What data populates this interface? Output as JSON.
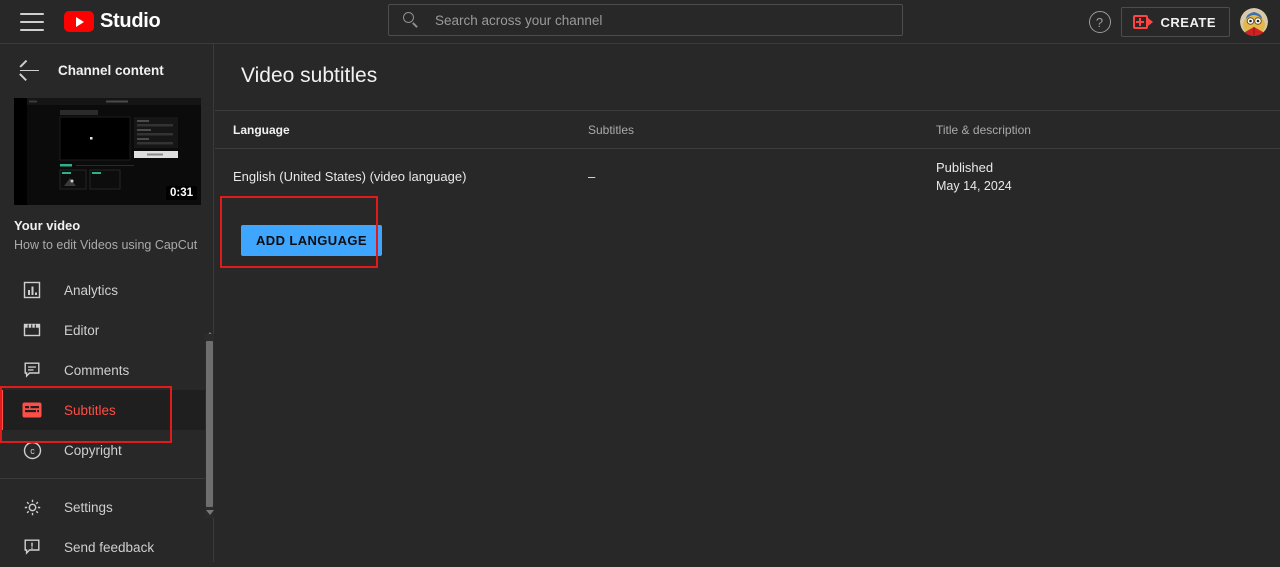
{
  "header": {
    "menu_icon": "hamburger-menu-icon",
    "brand": "Studio",
    "logo_icon": "youtube-logo-icon",
    "search": {
      "placeholder": "Search across your channel",
      "value": "",
      "icon": "search-icon"
    },
    "help_icon": "help-question-icon",
    "help_glyph": "?",
    "create_label": "CREATE",
    "create_icon": "video-camera-plus-icon",
    "avatar": "user-avatar"
  },
  "sidebar": {
    "back_icon": "back-arrow-icon",
    "channel_title": "Channel content",
    "video": {
      "duration": "0:31",
      "label": "Your video",
      "title": "How to edit Videos using CapCut"
    },
    "items": [
      {
        "label": "Analytics",
        "icon": "bar-chart-icon",
        "active": false
      },
      {
        "label": "Editor",
        "icon": "clapperboard-icon",
        "active": false
      },
      {
        "label": "Comments",
        "icon": "comment-icon",
        "active": false
      },
      {
        "label": "Subtitles",
        "icon": "subtitles-icon",
        "active": true
      },
      {
        "label": "Copyright",
        "icon": "copyright-icon",
        "active": false
      }
    ],
    "footer_items": [
      {
        "label": "Settings",
        "icon": "gear-icon"
      },
      {
        "label": "Send feedback",
        "icon": "feedback-icon"
      }
    ]
  },
  "main": {
    "page_title": "Video subtitles",
    "columns": {
      "language": "Language",
      "subtitles": "Subtitles",
      "title_description": "Title & description"
    },
    "rows": [
      {
        "language": "English (United States) (video language)",
        "subtitles": "–",
        "status": "Published",
        "date": "May 14, 2024"
      }
    ],
    "add_language_label": "ADD LANGUAGE"
  },
  "colors": {
    "background": "#282828",
    "sidebar_active_bg": "#1f1f1f",
    "accent_red": "#ff4e45",
    "brand_red": "#ff0000",
    "button_blue": "#3ea6ff",
    "annotation_red": "#e01b1b",
    "text_primary": "#f1f1f1",
    "text_secondary": "#aaaaaa"
  }
}
